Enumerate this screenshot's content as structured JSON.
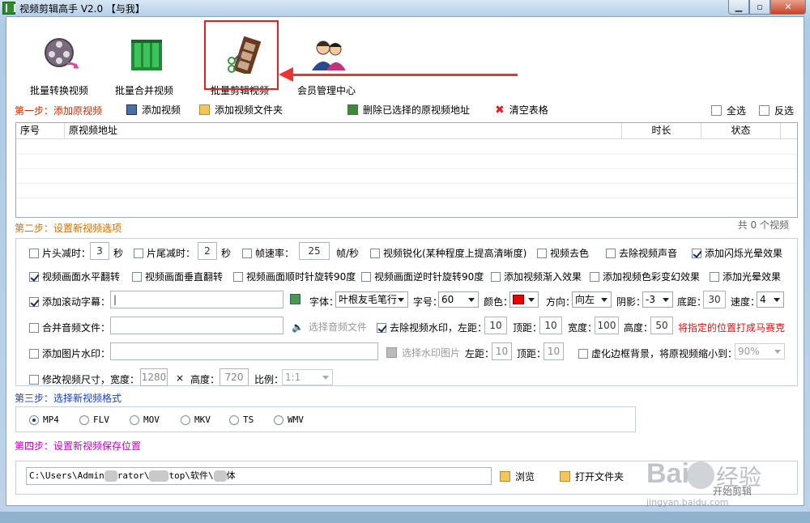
{
  "window": {
    "title": "视频剪辑高手 V2.0 【与我】"
  },
  "toolbar": [
    {
      "label": "批量转换视频"
    },
    {
      "label": "批量合并视频"
    },
    {
      "label": "批量剪辑视频"
    },
    {
      "label": "会员管理中心"
    }
  ],
  "step1": {
    "title": "第一步：添加原视频",
    "add_video": "添加视频",
    "add_folder": "添加视频文件夹",
    "delete_selected": "删除已选择的原视频地址",
    "clear_table": "清空表格",
    "select_all": "全选",
    "invert": "反选",
    "columns": [
      "序号",
      "原视频地址",
      "时长",
      "状态"
    ],
    "count": "共 0 个视频"
  },
  "step2": {
    "title": "第二步：设置新视频选项",
    "row1": {
      "head_cut": "片头减时：",
      "head_val": "3",
      "head_unit": "秒",
      "tail_cut": "片尾减时：",
      "tail_val": "2",
      "tail_unit": "秒",
      "fps": "帧速率：",
      "fps_val": "25",
      "fps_unit": "帧/秒",
      "sharpen": "视频锐化(某种程度上提高清晰度)",
      "decolor": "视频去色",
      "mute": "去除视频声音",
      "flash": "添加闪烁光晕效果"
    },
    "row2": {
      "hflip": "视频画面水平翻转",
      "vflip": "视频画面垂直翻转",
      "rot_cw": "视频画面顺时针旋转90度",
      "rot_ccw": "视频画面逆时针旋转90度",
      "fade": "添加视频渐入效果",
      "color_fx": "添加视频色彩变幻效果",
      "halo": "添加光晕效果"
    },
    "row3": {
      "subtitle": "添加滚动字幕：",
      "font_label": "字体：",
      "font_val": "叶根友毛笔行",
      "size_label": "字号：",
      "size_val": "60",
      "color_label": "颜色：",
      "color_val": "#ee0000",
      "dir_label": "方向：",
      "dir_val": "向左",
      "shadow_label": "阴影：",
      "shadow_val": "-3",
      "bottom_label": "底距：",
      "bottom_val": "30",
      "speed_label": "速度：",
      "speed_val": "4"
    },
    "row4": {
      "merge_audio": "合并音频文件：",
      "choose_audio": "选择音频文件",
      "remove_wm": "去除视频水印，左距：",
      "left_val": "10",
      "top_label": "顶距：",
      "top_val": "10",
      "width_label": "宽度：",
      "width_val": "100",
      "height_label": "高度：",
      "height_val": "50",
      "note": "将指定的位置打成马赛克"
    },
    "row5": {
      "img_wm": "添加图片水印：",
      "choose_wm": "选择水印图片",
      "left_label": "左距：",
      "left_val": "10",
      "top_label": "顶距：",
      "top_val": "10",
      "blur_bg": "虚化边框背景，将原视频缩小到：",
      "blur_val": "90%"
    },
    "row6": {
      "resize": "修改视频尺寸，宽度：",
      "w_val": "1280",
      "times": "×",
      "h_label": "高度：",
      "h_val": "720",
      "ratio_label": "比例：",
      "ratio_val": "1:1"
    }
  },
  "step3": {
    "title": "第三步：选择新视频格式",
    "formats": [
      "MP4",
      "FLV",
      "MOV",
      "MKV",
      "TS",
      "WMV"
    ],
    "selected": "MP4"
  },
  "step4": {
    "title": "第四步：设置新视频保存位置",
    "path_a": "C:\\Users\\Admin",
    "path_b": "rator\\",
    "path_c": "top\\软件\\",
    "path_d": "体",
    "browse": "浏览",
    "open_folder": "打开文件夹"
  },
  "watermark": {
    "brand": "Bai",
    "brand2": "经验",
    "sub": "jingyan.baidu.com",
    "badge": "开始剪辑"
  },
  "colors": {
    "step1": "#c03000",
    "step2": "#d07000",
    "step3": "#1a3fc0",
    "step4": "#c000c0",
    "highlight": "#e02222"
  }
}
